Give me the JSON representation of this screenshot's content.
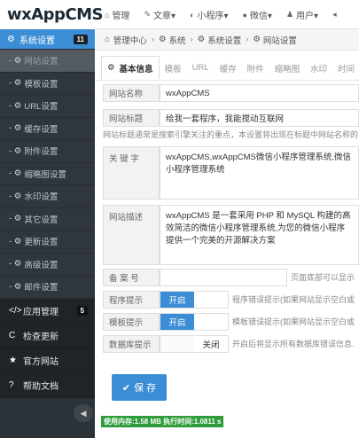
{
  "header": {
    "logo": "wxAppCMS",
    "nav": [
      {
        "icon": "home-icon",
        "glyph": "⌂",
        "label": "管理"
      },
      {
        "icon": "edit-icon",
        "glyph": "✎",
        "label": "文章▾"
      },
      {
        "icon": "mini-program-icon",
        "glyph": "◐",
        "label": "小程序▾"
      },
      {
        "icon": "wechat-icon",
        "glyph": "●",
        "label": "微信▾"
      },
      {
        "icon": "user-icon",
        "glyph": "♟",
        "label": "用户▾"
      },
      {
        "icon": "more-icon",
        "glyph": "◂",
        "label": ""
      }
    ]
  },
  "sidebar": {
    "active": {
      "label": "系统设置",
      "badge": "11"
    },
    "subitems": [
      "网站设置",
      "模板设置",
      "URL设置",
      "缓存设置",
      "附件设置",
      "缩略图设置",
      "水印设置",
      "其它设置",
      "更新设置",
      "高级设置",
      "邮件设置"
    ],
    "main": [
      {
        "icon": "code-icon",
        "glyph": "</>",
        "label": "应用管理",
        "badge": "5"
      },
      {
        "icon": "refresh-icon",
        "glyph": "C",
        "label": "检查更新",
        "badge": ""
      },
      {
        "icon": "star-icon",
        "glyph": "★",
        "label": "官方网站",
        "badge": ""
      },
      {
        "icon": "help-icon",
        "glyph": "?",
        "label": "帮助文档",
        "badge": ""
      }
    ]
  },
  "breadcrumb": [
    "管理中心",
    "系统",
    "系统设置",
    "网站设置"
  ],
  "tabs": [
    "基本信息",
    "模板",
    "URL",
    "缓存",
    "附件",
    "缩略图",
    "水印",
    "时间"
  ],
  "form": {
    "site_name": {
      "label": "网站名称",
      "value": "wxAppCMS"
    },
    "site_title": {
      "label": "网站标题",
      "value": "给我一套程序，我能搅动互联网",
      "help": "网站标题通常是搜索引擎关注的重点，本设置将出现在标题中网站名称的"
    },
    "keywords": {
      "label": "关 键 字",
      "value": "wxAppCMS,wxAppCMS微信小程序管理系统,微信小程序管理系统"
    },
    "description": {
      "label": "网站描述",
      "value": "wxAppCMS 是一套采用 PHP 和 MySQL 构建的高效简洁的微信小程序管理系统,为您的微信小程序提供一个完美的开源解决方案"
    },
    "icp": {
      "label": "备 案 号",
      "value": "",
      "help": "页面底部可以显示 I"
    },
    "app_tips": {
      "label": "程序提示",
      "on": "开启",
      "help": "程序错误提示(如果网站显示空白或"
    },
    "tpl_tips": {
      "label": "模板提示",
      "on": "开启",
      "help": "模板错误提示(如果网站显示空白或"
    },
    "db_tips": {
      "label": "数据库提示",
      "off": "关闭",
      "help": "开启后将显示所有数据库错误信息."
    }
  },
  "save_label": "保 存",
  "footer": "使用内存:1.58 MB 执行时间:1.0811 s",
  "colors": {
    "accent": "#3b8ed6",
    "sidebar": "#2b3238",
    "footer": "#2e9c3a"
  }
}
